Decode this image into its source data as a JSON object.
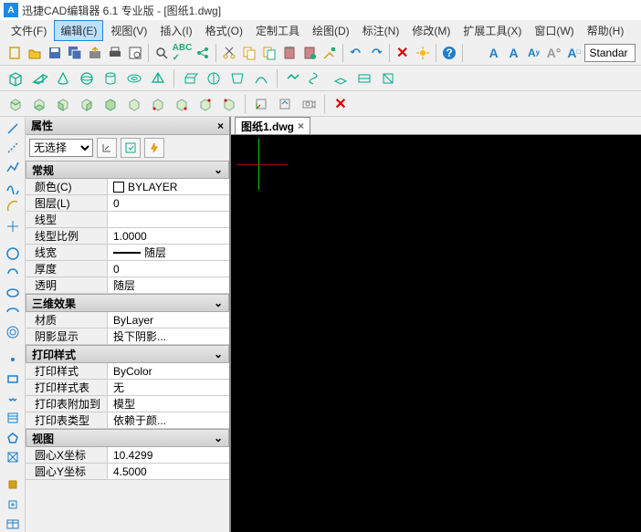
{
  "title": "迅捷CAD编辑器 6.1 专业版  -  [图纸1.dwg]",
  "menu": {
    "file": "文件(F)",
    "edit": "编辑(E)",
    "view": "视图(V)",
    "insert": "插入(I)",
    "format": "格式(O)",
    "customTools": "定制工具",
    "draw": "绘图(D)",
    "annotate": "标注(N)",
    "modify": "修改(M)",
    "extTools": "扩展工具(X)",
    "window": "窗口(W)",
    "help": "帮助(H)"
  },
  "style_combo": "Standar",
  "doc_tab": "图纸1.dwg",
  "prop": {
    "title": "属性",
    "selection": "无选择",
    "sections": {
      "general": {
        "title": "常规",
        "rows": [
          {
            "k": "颜色(C)",
            "v": "BYLAYER",
            "swatch": true
          },
          {
            "k": "图层(L)",
            "v": "0"
          },
          {
            "k": "线型",
            "v": ""
          },
          {
            "k": "线型比例",
            "v": "1.0000"
          },
          {
            "k": "线宽",
            "v": "随层",
            "line": true
          },
          {
            "k": "厚度",
            "v": "0"
          },
          {
            "k": "透明",
            "v": "随层"
          }
        ]
      },
      "effect3d": {
        "title": "三维效果",
        "rows": [
          {
            "k": "材质",
            "v": "ByLayer"
          },
          {
            "k": "阴影显示",
            "v": "投下阴影..."
          }
        ]
      },
      "printStyle": {
        "title": "打印样式",
        "rows": [
          {
            "k": "打印样式",
            "v": "ByColor"
          },
          {
            "k": "打印样式表",
            "v": "无"
          },
          {
            "k": "打印表附加到",
            "v": "模型"
          },
          {
            "k": "打印表类型",
            "v": "依赖于颜..."
          }
        ]
      },
      "view": {
        "title": "视图",
        "rows": [
          {
            "k": "圆心X坐标",
            "v": "10.4299"
          },
          {
            "k": "圆心Y坐标",
            "v": "4.5000"
          }
        ]
      }
    }
  }
}
